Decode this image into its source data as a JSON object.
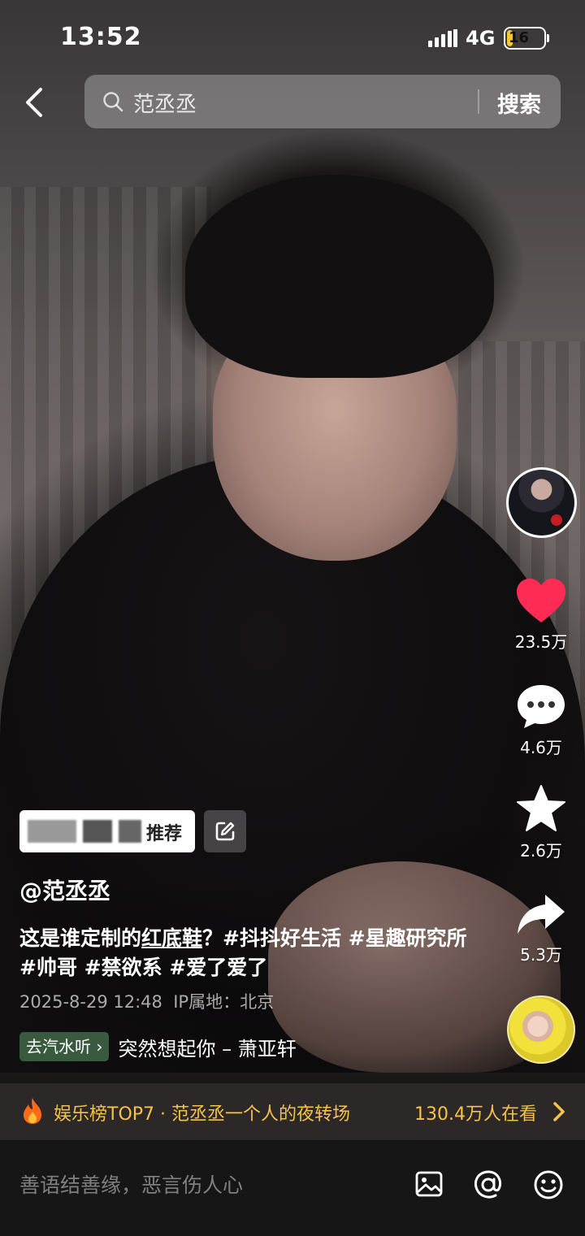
{
  "status_bar": {
    "time": "13:52",
    "network": "4G",
    "battery": "16",
    "battery_level": 0.16
  },
  "search": {
    "query": "范丞丞",
    "button": "搜索"
  },
  "actions": {
    "like_count": "23.5万",
    "comment_count": "4.6万",
    "favorite_count": "2.6万",
    "share_count": "5.3万",
    "like_color": "#fe2c55"
  },
  "recommend": {
    "label": "推荐"
  },
  "post": {
    "author": "@范丞丞",
    "caption_prefix": "这是谁定制的",
    "caption_underlined": "红底鞋",
    "caption_suffix": "？#抖抖好生活 #星趣研究所#帅哥 #禁欲系 #爱了爱了",
    "date": "2025-8-29 12:48",
    "ip_location": "IP属地：北京"
  },
  "music": {
    "chip_label": "去汽水听 ›",
    "title": "突然想起你 – 萧亚轩"
  },
  "hot_bar": {
    "text": "娱乐榜TOP7 · 范丞丞一个人的夜转场",
    "viewers": "130.4万人在看",
    "accent": "#f5c34a"
  },
  "comment_bar": {
    "placeholder": "善语结善缘，恶言伤人心"
  }
}
